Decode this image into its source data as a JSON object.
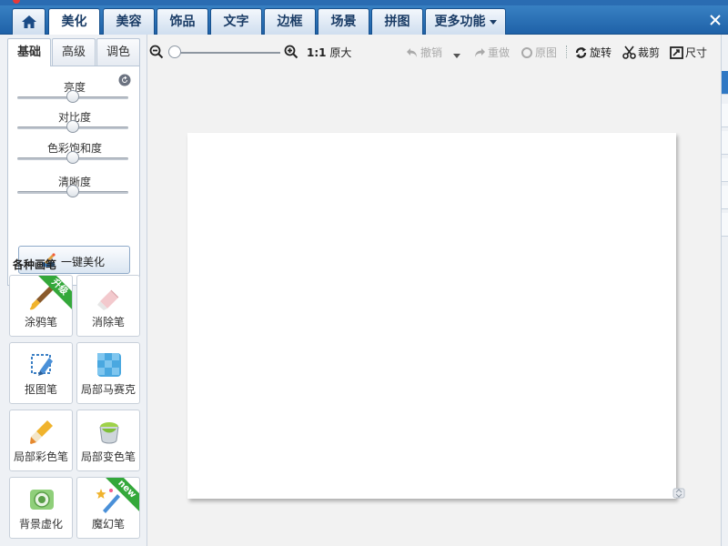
{
  "nav": {
    "tabs": [
      {
        "label": "美化"
      },
      {
        "label": "美容"
      },
      {
        "label": "饰品"
      },
      {
        "label": "文字"
      },
      {
        "label": "边框"
      },
      {
        "label": "场景"
      },
      {
        "label": "拼图"
      },
      {
        "label": "更多功能"
      }
    ],
    "active_tab": "美化"
  },
  "left_panel": {
    "subtabs": [
      {
        "label": "基础"
      },
      {
        "label": "高级"
      },
      {
        "label": "调色"
      }
    ],
    "active_subtab": "基础",
    "sliders": [
      {
        "label": "亮度",
        "value": 0.5
      },
      {
        "label": "对比度",
        "value": 0.5
      },
      {
        "label": "色彩饱和度",
        "value": 0.5
      },
      {
        "label": "清晰度",
        "value": 0.5
      }
    ],
    "one_click_button": "一键美化",
    "brush_section_title": "各种画笔",
    "brushes": [
      {
        "label": "涂鸦笔",
        "icon": "paintbrush-icon",
        "badge": "升级"
      },
      {
        "label": "消除笔",
        "icon": "eraser-icon"
      },
      {
        "label": "抠图笔",
        "icon": "cutout-pen-icon"
      },
      {
        "label": "局部马赛克",
        "icon": "mosaic-icon"
      },
      {
        "label": "局部彩色笔",
        "icon": "color-brush-icon"
      },
      {
        "label": "局部变色笔",
        "icon": "paint-bucket-icon"
      },
      {
        "label": "背景虚化",
        "icon": "blur-icon"
      },
      {
        "label": "魔幻笔",
        "icon": "magic-pen-icon",
        "badge": "new"
      }
    ]
  },
  "toolbar": {
    "zoom_value": 0.0,
    "ratio_label": "1:1",
    "original_size": "原大",
    "undo": "撤销",
    "redo": "重做",
    "original": "原图",
    "rotate": "旋转",
    "crop": "裁剪",
    "size": "尺寸"
  },
  "colors": {
    "nav_bar": "#2a6cb2",
    "badge_green": "#34a83a",
    "canvas": "#ffffff"
  }
}
